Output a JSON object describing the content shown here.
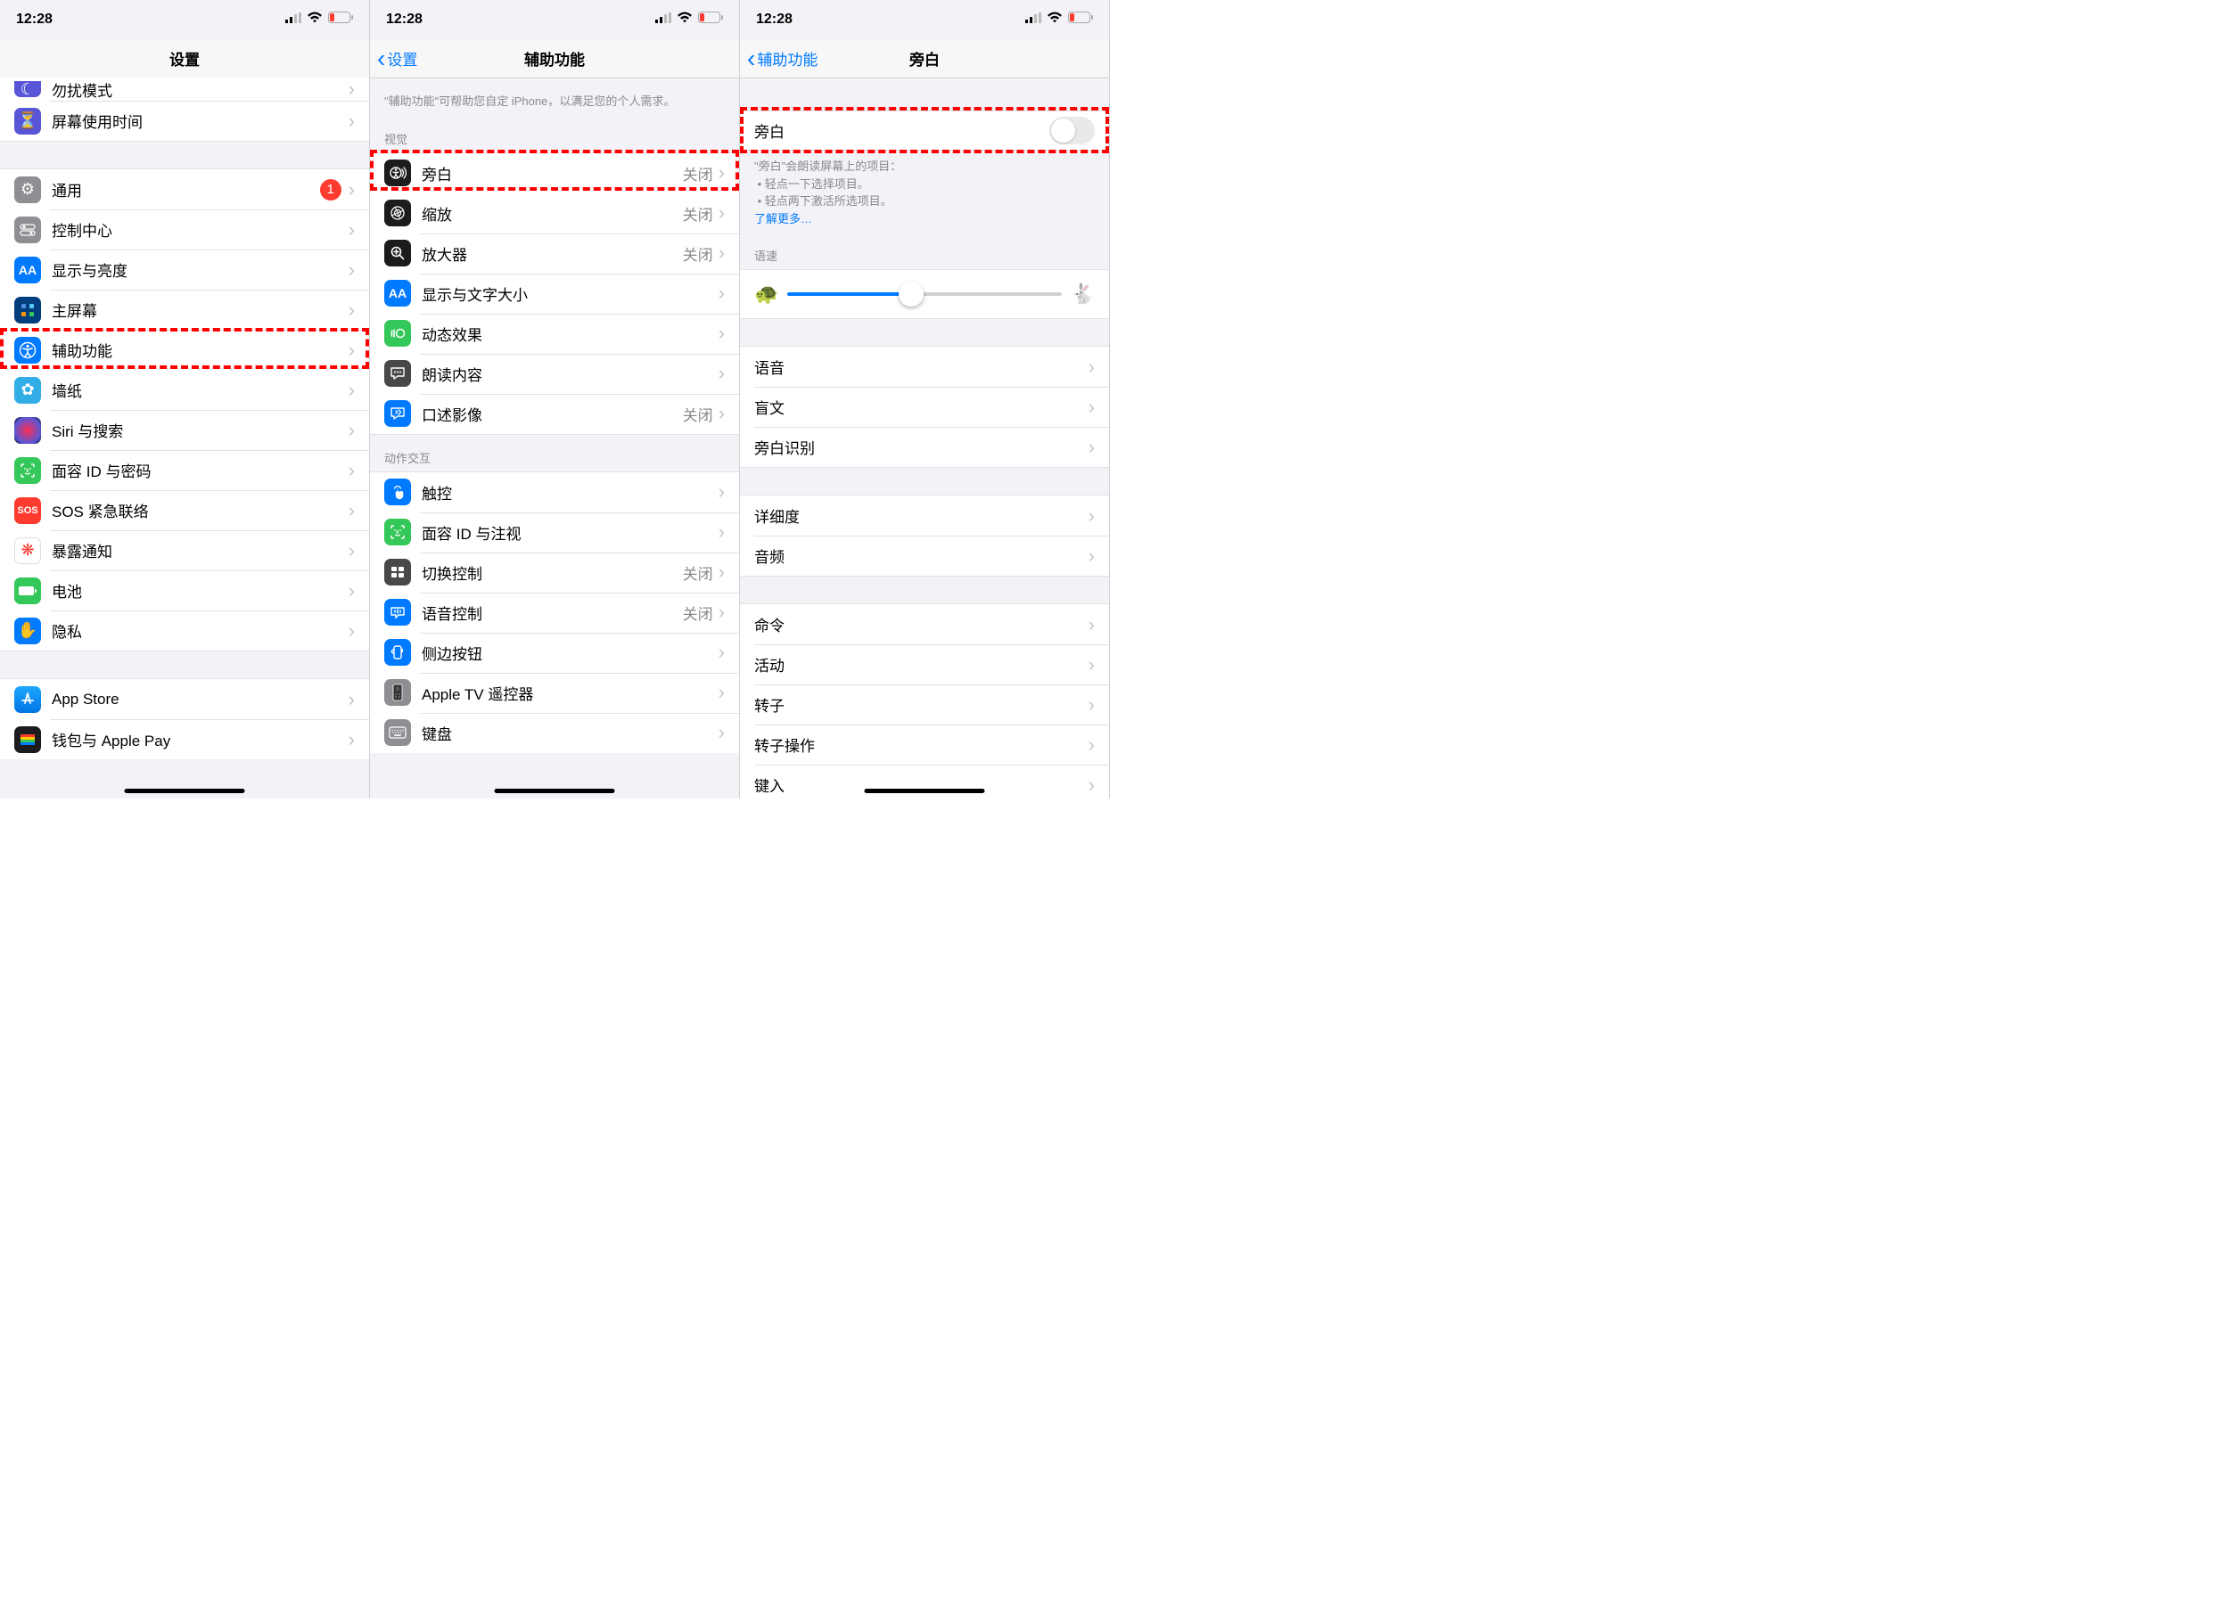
{
  "status": {
    "time": "12:28"
  },
  "panel1": {
    "title": "设置",
    "cells": [
      {
        "icon": "moon-icon",
        "bg": "ic-purple",
        "label": "勿扰模式"
      },
      {
        "icon": "hourglass-icon",
        "bg": "ic-indigo",
        "label": "屏幕使用时间"
      }
    ],
    "groupB": [
      {
        "icon": "gear-icon",
        "bg": "ic-gray",
        "label": "通用",
        "badge": "1"
      },
      {
        "icon": "switches-icon",
        "bg": "ic-gray",
        "label": "控制中心"
      },
      {
        "icon": "aa-icon",
        "bg": "ic-blue",
        "label": "显示与亮度"
      },
      {
        "icon": "grid-icon",
        "bg": "ic-navy",
        "label": "主屏幕"
      },
      {
        "icon": "accessibility-icon",
        "bg": "ic-blue",
        "label": "辅助功能",
        "highlight": true
      },
      {
        "icon": "flower-icon",
        "bg": "ic-cyan",
        "label": "墙纸"
      },
      {
        "icon": "siri-icon",
        "bg": "ic-black",
        "label": "Siri 与搜索"
      },
      {
        "icon": "faceid-icon",
        "bg": "ic-green",
        "label": "面容 ID 与密码"
      },
      {
        "icon": "sos-icon",
        "bg": "ic-red",
        "label": "SOS 紧急联络"
      },
      {
        "icon": "virus-icon",
        "bg": "ic-white",
        "label": "暴露通知"
      },
      {
        "icon": "battery-icon",
        "bg": "ic-green",
        "label": "电池"
      },
      {
        "icon": "hand-icon",
        "bg": "ic-blue",
        "label": "隐私"
      }
    ],
    "groupC": [
      {
        "icon": "appstore-icon",
        "bg": "ic-blue",
        "label": "App Store"
      },
      {
        "icon": "wallet-icon",
        "bg": "ic-black",
        "label": "钱包与 Apple Pay"
      }
    ]
  },
  "panel2": {
    "back": "设置",
    "title": "辅助功能",
    "intro": "\"辅助功能\"可帮助您自定 iPhone，以满足您的个人需求。",
    "sectVision": "视觉",
    "vision": [
      {
        "icon": "voiceover-icon",
        "bg": "ic-black",
        "label": "旁白",
        "detail": "关闭",
        "highlight": true
      },
      {
        "icon": "zoom-icon",
        "bg": "ic-black",
        "label": "缩放",
        "detail": "关闭"
      },
      {
        "icon": "magnifier-icon",
        "bg": "ic-black",
        "label": "放大器",
        "detail": "关闭"
      },
      {
        "icon": "aa-icon",
        "bg": "ic-blue",
        "label": "显示与文字大小"
      },
      {
        "icon": "motion-icon",
        "bg": "ic-green",
        "label": "动态效果"
      },
      {
        "icon": "speech-icon",
        "bg": "ic-dkgray",
        "label": "朗读内容"
      },
      {
        "icon": "audio-desc-icon",
        "bg": "ic-blue",
        "label": "口述影像",
        "detail": "关闭"
      }
    ],
    "sectMotion": "动作交互",
    "motion": [
      {
        "icon": "touch-icon",
        "bg": "ic-blue",
        "label": "触控"
      },
      {
        "icon": "faceid-icon",
        "bg": "ic-green",
        "label": "面容 ID 与注视"
      },
      {
        "icon": "switch-ctrl-icon",
        "bg": "ic-dkgray",
        "label": "切换控制",
        "detail": "关闭"
      },
      {
        "icon": "voice-ctrl-icon",
        "bg": "ic-blue",
        "label": "语音控制",
        "detail": "关闭"
      },
      {
        "icon": "side-btn-icon",
        "bg": "ic-blue",
        "label": "侧边按钮"
      },
      {
        "icon": "remote-icon",
        "bg": "ic-gray",
        "label": "Apple TV 遥控器"
      },
      {
        "icon": "keyboard-icon",
        "bg": "ic-gray",
        "label": "键盘"
      }
    ]
  },
  "panel3": {
    "back": "辅助功能",
    "title": "旁白",
    "toggle_label": "旁白",
    "desc_line1": "\"旁白\"会朗读屏幕上的项目：",
    "desc_li1": "轻点一下选择项目。",
    "desc_li2": "轻点两下激活所选项目。",
    "learn_more": "了解更多…",
    "speed_header": "语速",
    "slider_pct": 45,
    "groupA": [
      {
        "label": "语音"
      },
      {
        "label": "盲文"
      },
      {
        "label": "旁白识别"
      }
    ],
    "groupB": [
      {
        "label": "详细度"
      },
      {
        "label": "音频"
      }
    ],
    "groupC": [
      {
        "label": "命令"
      },
      {
        "label": "活动"
      },
      {
        "label": "转子"
      },
      {
        "label": "转子操作"
      },
      {
        "label": "键入"
      }
    ]
  }
}
